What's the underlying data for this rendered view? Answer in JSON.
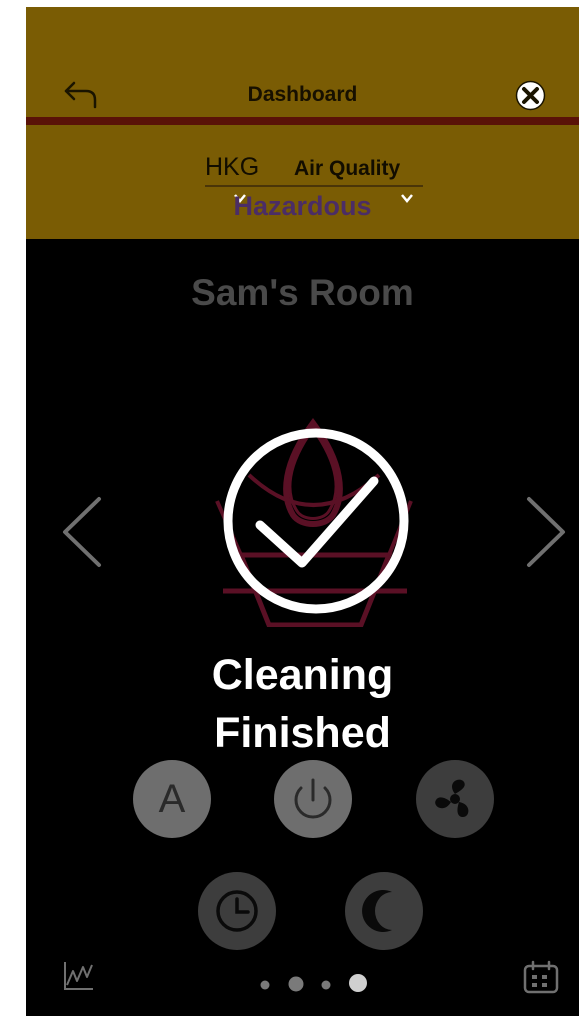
{
  "header": {
    "title": "Dashboard",
    "air_quality": {
      "city": "HKG",
      "label": "Air Quality",
      "status": "Hazardous"
    }
  },
  "room": {
    "name": "Sam's Room"
  },
  "status": {
    "line1": "Cleaning",
    "line2": "Finished"
  },
  "controls": {
    "auto_label": "A",
    "buttons": [
      "auto-mode",
      "power",
      "fan",
      "timer",
      "sleep"
    ]
  },
  "pager": {
    "total": 4,
    "active": 4
  },
  "icons": [
    "back-arrow-icon",
    "close-icon",
    "chevron-left-icon",
    "chevron-right-icon",
    "check-circle-icon",
    "power-icon",
    "fan-icon",
    "clock-icon",
    "moon-icon",
    "chart-icon",
    "calendar-icon"
  ],
  "colors": {
    "header": "#7a5c04",
    "header_bar": "#5a1208",
    "status_hazardous": "#4b2d66",
    "device_outline": "#5a1025",
    "background": "#000000"
  }
}
